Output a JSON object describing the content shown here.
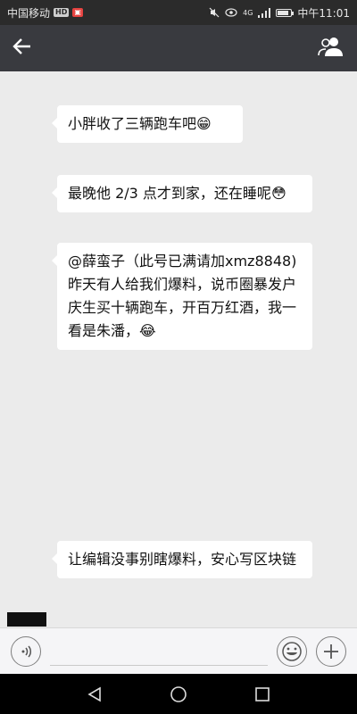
{
  "status_bar": {
    "carrier": "中国移动",
    "hd_badge": "HD",
    "time": "中午11:01",
    "network": "4G",
    "battery_level": 0.8
  },
  "nav": {
    "back_icon": "arrow-left-icon",
    "title": "",
    "people_icon": "group-icon"
  },
  "messages": [
    {
      "text": "小胖收了三辆跑车吧",
      "emoji": "😁"
    },
    {
      "text": "最晚他 2/3 点才到家，还在睡呢",
      "emoji": "😳"
    },
    {
      "text": "@薛蛮子（此号已满请加xmz8848) 昨天有人给我们爆料，说币圈暴发户庆生买十辆跑车，开百万红酒，我一看是朱潘，",
      "emoji": "😂"
    },
    {
      "text": "让编辑没事别瞎爆料，安心写区块链",
      "emoji": ""
    }
  ],
  "input": {
    "value": "",
    "voice_icon": "voice-icon",
    "emoji_icon": "smiley-icon",
    "plus_icon": "plus-icon"
  },
  "system_nav": {
    "back": "triangle-back-icon",
    "home": "circle-home-icon",
    "recents": "square-recents-icon"
  }
}
